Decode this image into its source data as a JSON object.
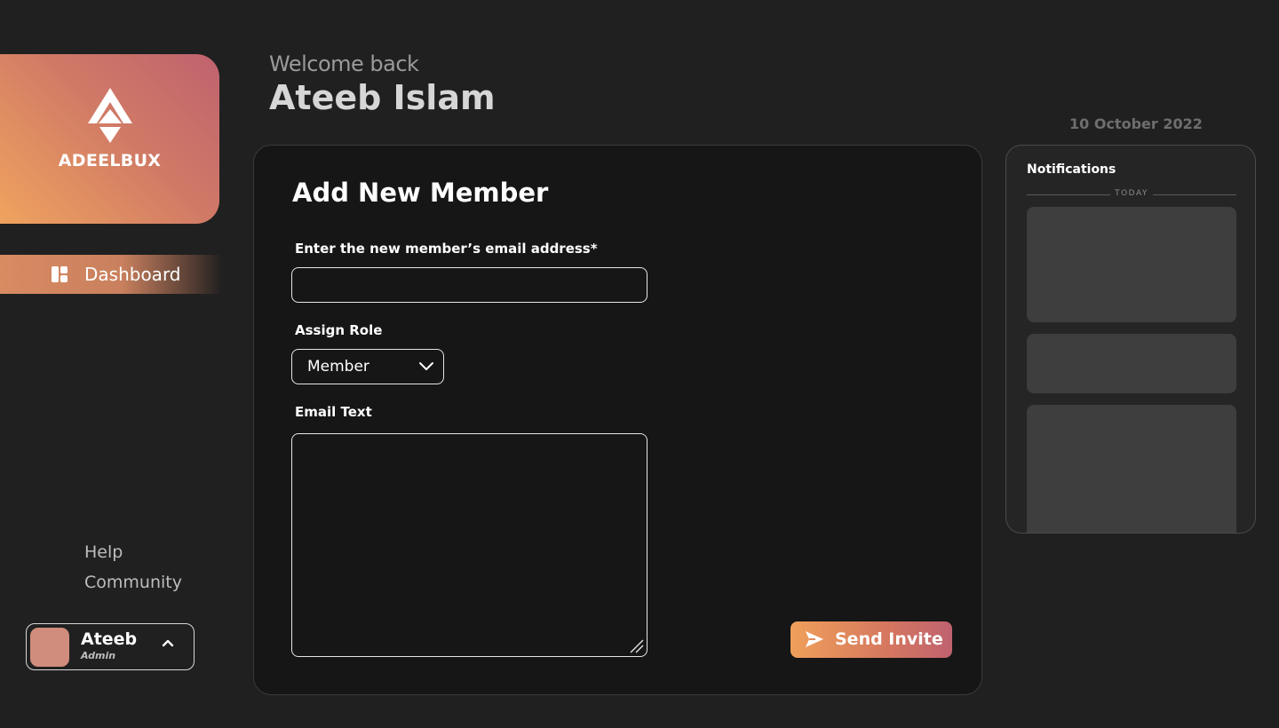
{
  "brand": {
    "name": "ADEELBUX",
    "logo_icon": "arrow-logo-icon"
  },
  "sidebar": {
    "items": [
      {
        "label": "Dashboard",
        "icon": "dashboard-icon",
        "active": true
      }
    ],
    "footer_links": [
      {
        "label": "Help"
      },
      {
        "label": "Community"
      }
    ]
  },
  "user": {
    "name": "Ateeb",
    "role": "Admin",
    "toggle_icon": "chevron-up-icon"
  },
  "header": {
    "welcome": "Welcome back",
    "full_name": "Ateeb Islam",
    "date": "10 October 2022"
  },
  "form": {
    "title": "Add New Member",
    "email_label": "Enter the new member’s email address*",
    "email_value": "",
    "email_placeholder": "",
    "role_label": "Assign Role",
    "role_value": "Member",
    "email_text_label": "Email Text",
    "email_text_value": "",
    "send_label": "Send Invite",
    "send_icon": "send-icon"
  },
  "notifications": {
    "title": "Notifications",
    "group_label": "TODAY",
    "cards": [
      {},
      {},
      {}
    ]
  },
  "colors": {
    "background": "#202020",
    "panel": "#161616",
    "accent_start": "#f0a05a",
    "accent_end": "#c0626f"
  }
}
